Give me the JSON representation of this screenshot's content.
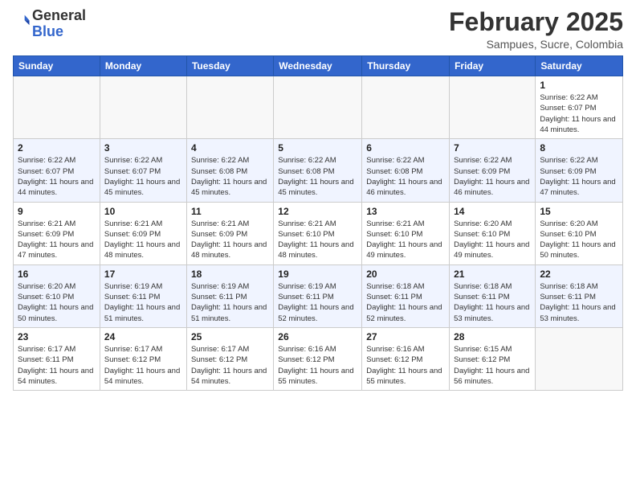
{
  "header": {
    "logo_line1": "General",
    "logo_line2": "Blue",
    "month": "February 2025",
    "location": "Sampues, Sucre, Colombia"
  },
  "days_of_week": [
    "Sunday",
    "Monday",
    "Tuesday",
    "Wednesday",
    "Thursday",
    "Friday",
    "Saturday"
  ],
  "weeks": [
    [
      {
        "day": "",
        "info": ""
      },
      {
        "day": "",
        "info": ""
      },
      {
        "day": "",
        "info": ""
      },
      {
        "day": "",
        "info": ""
      },
      {
        "day": "",
        "info": ""
      },
      {
        "day": "",
        "info": ""
      },
      {
        "day": "1",
        "info": "Sunrise: 6:22 AM\nSunset: 6:07 PM\nDaylight: 11 hours and 44 minutes."
      }
    ],
    [
      {
        "day": "2",
        "info": "Sunrise: 6:22 AM\nSunset: 6:07 PM\nDaylight: 11 hours and 44 minutes."
      },
      {
        "day": "3",
        "info": "Sunrise: 6:22 AM\nSunset: 6:07 PM\nDaylight: 11 hours and 45 minutes."
      },
      {
        "day": "4",
        "info": "Sunrise: 6:22 AM\nSunset: 6:08 PM\nDaylight: 11 hours and 45 minutes."
      },
      {
        "day": "5",
        "info": "Sunrise: 6:22 AM\nSunset: 6:08 PM\nDaylight: 11 hours and 45 minutes."
      },
      {
        "day": "6",
        "info": "Sunrise: 6:22 AM\nSunset: 6:08 PM\nDaylight: 11 hours and 46 minutes."
      },
      {
        "day": "7",
        "info": "Sunrise: 6:22 AM\nSunset: 6:09 PM\nDaylight: 11 hours and 46 minutes."
      },
      {
        "day": "8",
        "info": "Sunrise: 6:22 AM\nSunset: 6:09 PM\nDaylight: 11 hours and 47 minutes."
      }
    ],
    [
      {
        "day": "9",
        "info": "Sunrise: 6:21 AM\nSunset: 6:09 PM\nDaylight: 11 hours and 47 minutes."
      },
      {
        "day": "10",
        "info": "Sunrise: 6:21 AM\nSunset: 6:09 PM\nDaylight: 11 hours and 48 minutes."
      },
      {
        "day": "11",
        "info": "Sunrise: 6:21 AM\nSunset: 6:09 PM\nDaylight: 11 hours and 48 minutes."
      },
      {
        "day": "12",
        "info": "Sunrise: 6:21 AM\nSunset: 6:10 PM\nDaylight: 11 hours and 48 minutes."
      },
      {
        "day": "13",
        "info": "Sunrise: 6:21 AM\nSunset: 6:10 PM\nDaylight: 11 hours and 49 minutes."
      },
      {
        "day": "14",
        "info": "Sunrise: 6:20 AM\nSunset: 6:10 PM\nDaylight: 11 hours and 49 minutes."
      },
      {
        "day": "15",
        "info": "Sunrise: 6:20 AM\nSunset: 6:10 PM\nDaylight: 11 hours and 50 minutes."
      }
    ],
    [
      {
        "day": "16",
        "info": "Sunrise: 6:20 AM\nSunset: 6:10 PM\nDaylight: 11 hours and 50 minutes."
      },
      {
        "day": "17",
        "info": "Sunrise: 6:19 AM\nSunset: 6:11 PM\nDaylight: 11 hours and 51 minutes."
      },
      {
        "day": "18",
        "info": "Sunrise: 6:19 AM\nSunset: 6:11 PM\nDaylight: 11 hours and 51 minutes."
      },
      {
        "day": "19",
        "info": "Sunrise: 6:19 AM\nSunset: 6:11 PM\nDaylight: 11 hours and 52 minutes."
      },
      {
        "day": "20",
        "info": "Sunrise: 6:18 AM\nSunset: 6:11 PM\nDaylight: 11 hours and 52 minutes."
      },
      {
        "day": "21",
        "info": "Sunrise: 6:18 AM\nSunset: 6:11 PM\nDaylight: 11 hours and 53 minutes."
      },
      {
        "day": "22",
        "info": "Sunrise: 6:18 AM\nSunset: 6:11 PM\nDaylight: 11 hours and 53 minutes."
      }
    ],
    [
      {
        "day": "23",
        "info": "Sunrise: 6:17 AM\nSunset: 6:11 PM\nDaylight: 11 hours and 54 minutes."
      },
      {
        "day": "24",
        "info": "Sunrise: 6:17 AM\nSunset: 6:12 PM\nDaylight: 11 hours and 54 minutes."
      },
      {
        "day": "25",
        "info": "Sunrise: 6:17 AM\nSunset: 6:12 PM\nDaylight: 11 hours and 54 minutes."
      },
      {
        "day": "26",
        "info": "Sunrise: 6:16 AM\nSunset: 6:12 PM\nDaylight: 11 hours and 55 minutes."
      },
      {
        "day": "27",
        "info": "Sunrise: 6:16 AM\nSunset: 6:12 PM\nDaylight: 11 hours and 55 minutes."
      },
      {
        "day": "28",
        "info": "Sunrise: 6:15 AM\nSunset: 6:12 PM\nDaylight: 11 hours and 56 minutes."
      },
      {
        "day": "",
        "info": ""
      }
    ]
  ]
}
